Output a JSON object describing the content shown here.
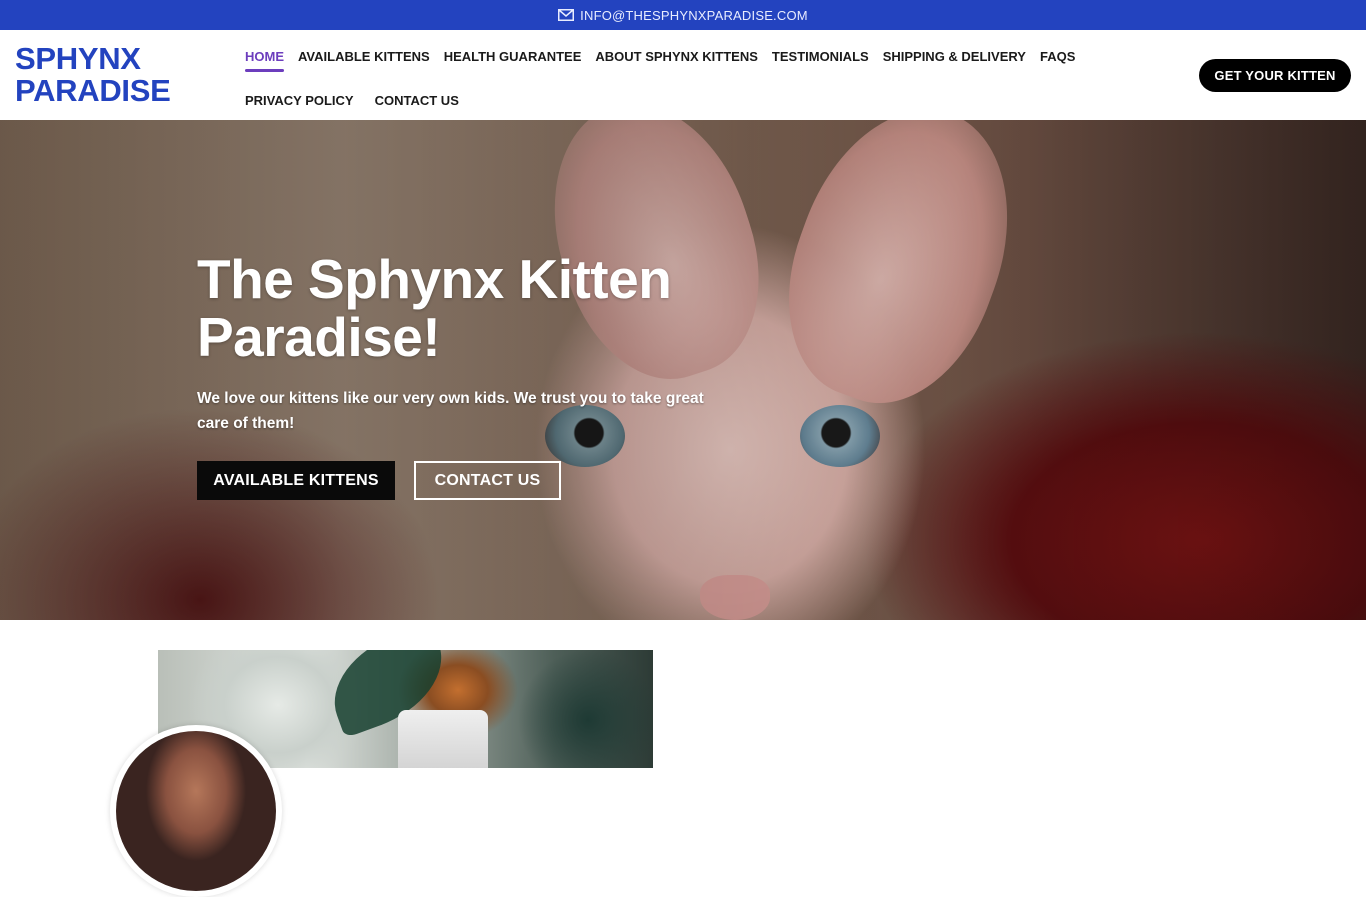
{
  "topbar": {
    "email": "INFO@THESPHYNXPARADISE.COM",
    "icon": "envelope-icon",
    "background": "#2343bf"
  },
  "header": {
    "logo_line1": "SPHYNX",
    "logo_line2": "PARADISE",
    "logo_color": "#2343bf",
    "nav": [
      {
        "label": "HOME",
        "active": true
      },
      {
        "label": "AVAILABLE KITTENS",
        "active": false
      },
      {
        "label": "HEALTH GUARANTEE",
        "active": false
      },
      {
        "label": "ABOUT SPHYNX KITTENS",
        "active": false
      },
      {
        "label": "TESTIMONIALS",
        "active": false
      },
      {
        "label": "SHIPPING & DELIVERY",
        "active": false
      },
      {
        "label": "FAQS",
        "active": false
      },
      {
        "label": "PRIVACY POLICY",
        "active": false
      },
      {
        "label": "CONTACT US",
        "active": false
      }
    ],
    "active_color": "#6c3dbd",
    "cta_label": "GET YOUR KITTEN"
  },
  "hero": {
    "title": "The Sphynx Kitten Paradise!",
    "subtitle": "We love our kittens like our very own kids. We trust you to take great care of them!",
    "primary_button": "AVAILABLE KITTENS",
    "secondary_button": "CONTACT US"
  }
}
